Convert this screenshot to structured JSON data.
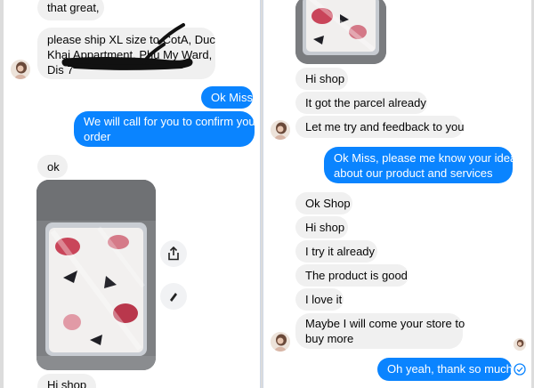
{
  "left": {
    "messages": [
      {
        "side": "in",
        "text": "that great,"
      },
      {
        "side": "in",
        "lines": [
          "please ship XL size to CotA, Duc",
          "Khai Appartment, Phu My Ward,",
          "Dis 7"
        ]
      },
      {
        "side": "out",
        "text": "Ok Miss"
      },
      {
        "side": "out",
        "lines": [
          "We will call for you to confirm your",
          "order"
        ]
      },
      {
        "side": "in",
        "text": "ok"
      },
      {
        "side": "in",
        "text": "Hi shop"
      }
    ]
  },
  "right": {
    "messages": [
      {
        "side": "in",
        "text": "Hi shop"
      },
      {
        "side": "in",
        "text": "It got the parcel already"
      },
      {
        "side": "in",
        "text": "Let me try and feedback to you"
      },
      {
        "side": "out",
        "lines": [
          "Ok Miss, please me know your idea",
          "about our product and services"
        ]
      },
      {
        "side": "in",
        "text": "Ok Shop"
      },
      {
        "side": "in",
        "text": "Hi shop"
      },
      {
        "side": "in",
        "text": "I try it already"
      },
      {
        "side": "in",
        "text": "The product is good"
      },
      {
        "side": "in",
        "text": "I love it"
      },
      {
        "side": "in",
        "lines": [
          "Maybe I will come your store to",
          "buy more"
        ]
      },
      {
        "side": "out",
        "text": "Oh yeah, thank so much"
      }
    ]
  },
  "icons": {
    "share": "share-icon",
    "edit": "pencil-icon",
    "status": "seen-check-icon"
  },
  "colors": {
    "outgoing_bubble": "#0a84ff",
    "incoming_bubble": "#f0f0f0"
  }
}
